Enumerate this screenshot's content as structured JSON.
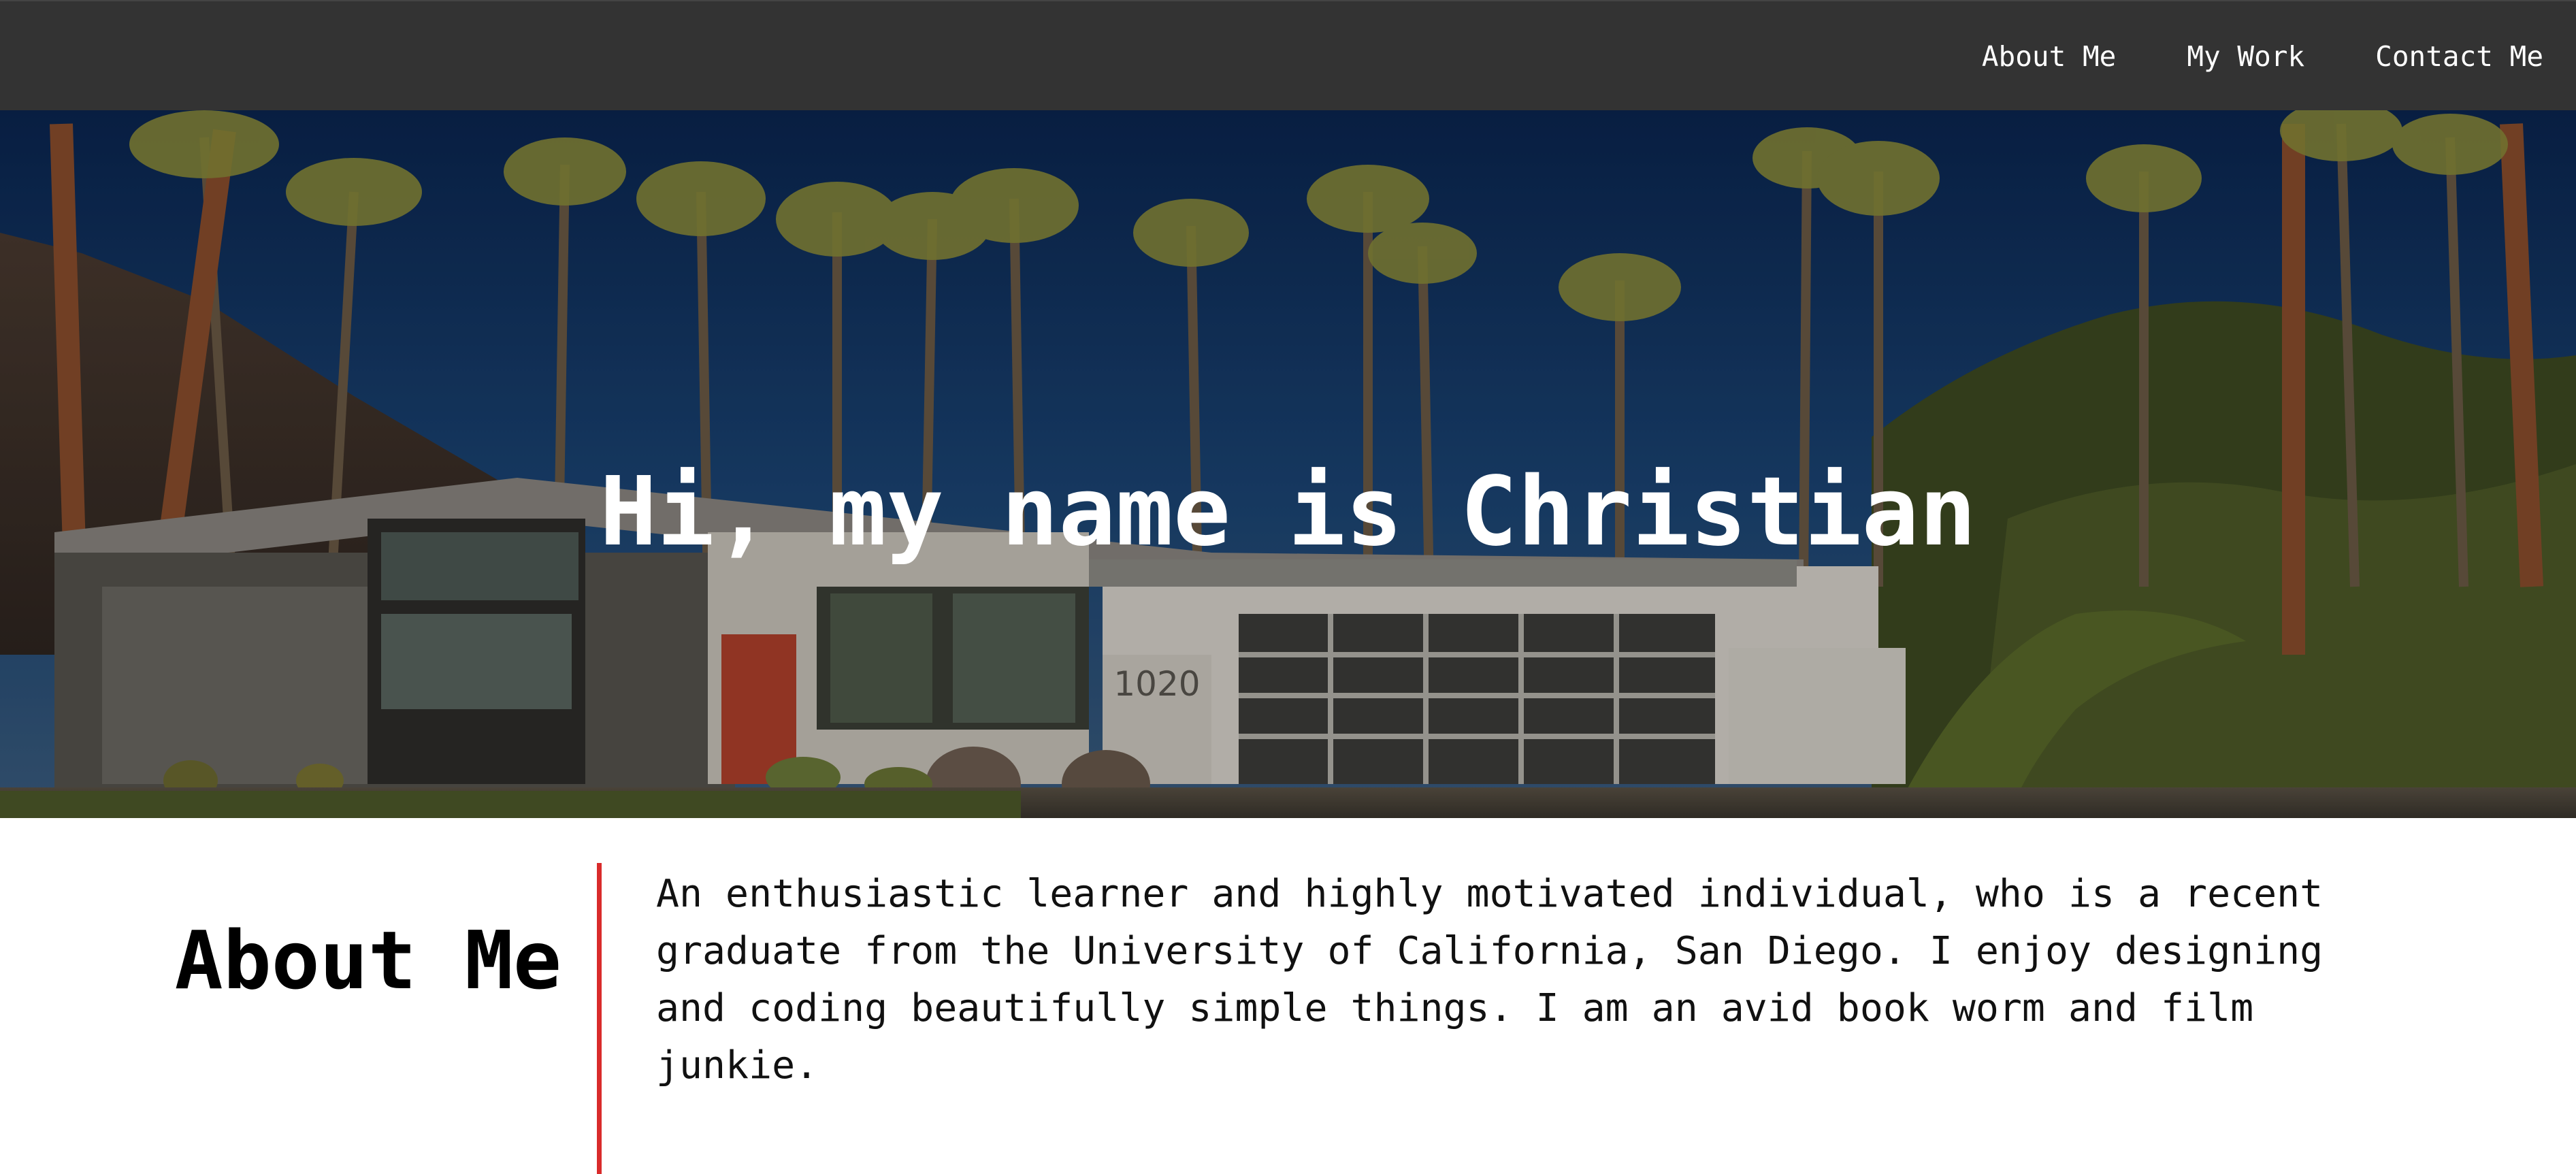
{
  "nav": {
    "links": [
      {
        "label": "About Me"
      },
      {
        "label": "My Work"
      },
      {
        "label": "Contact Me"
      }
    ]
  },
  "hero": {
    "title": "Hi, my name is Christian",
    "house_number": "1020"
  },
  "about": {
    "heading": "About Me",
    "body": "An enthusiastic learner and highly motivated individual, who is a recent graduate from the University of California, San Diego. I enjoy designing and coding beautifully simple things. I am an avid book worm and film junkie."
  },
  "colors": {
    "nav_bg": "#333333",
    "accent": "#d92b2b",
    "text": "#000000"
  }
}
